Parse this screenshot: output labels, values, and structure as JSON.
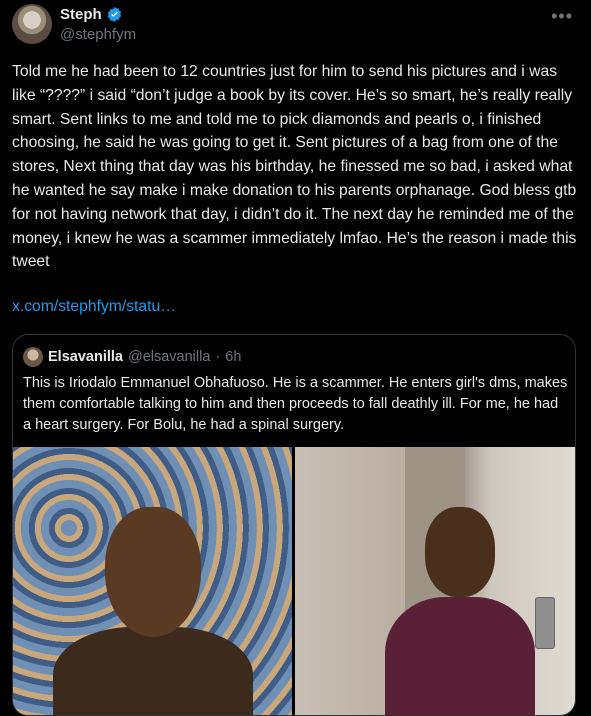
{
  "author": {
    "name": "Steph",
    "handle": "@stephfym",
    "verified": true
  },
  "tweet": {
    "text": "Told me he had been to 12 countries just for him to send his pictures and i was like “????” i said “don’t judge a book by its cover. He’s so smart, he’s really really smart. Sent links to me and told me to pick diamonds and pearls o, i finished choosing, he said he was going to get it. Sent pictures of a bag from one of the stores, Next thing that day was his birthday, he finessed me so bad, i asked what he wanted he say make i make donation to his parents orphanage. God bless gtb for not having network that day, i didn’t do it. The next day he reminded me of the money, i knew he was a scammer immediately lmfao. He’s the reason i made this tweet",
    "link": "x.com/stephfym/statu…"
  },
  "quote": {
    "name": "Elsavanilla",
    "handle": "@elsavanilla",
    "dot": "·",
    "time": "6h",
    "text": "This is Iriodalo Emmanuel Obhafuoso. He is a scammer. He enters girl's dms, makes them comfortable talking to him and then proceeds to fall deathly ill. For me, he had a heart surgery. For Bolu, he had a spinal surgery."
  },
  "icons": {
    "more": "more-icon",
    "verified": "verified-badge-icon"
  },
  "colors": {
    "background": "#000000",
    "text": "#e7e9ea",
    "muted": "#71767b",
    "link": "#1d9bf0",
    "border": "#2f3336"
  }
}
